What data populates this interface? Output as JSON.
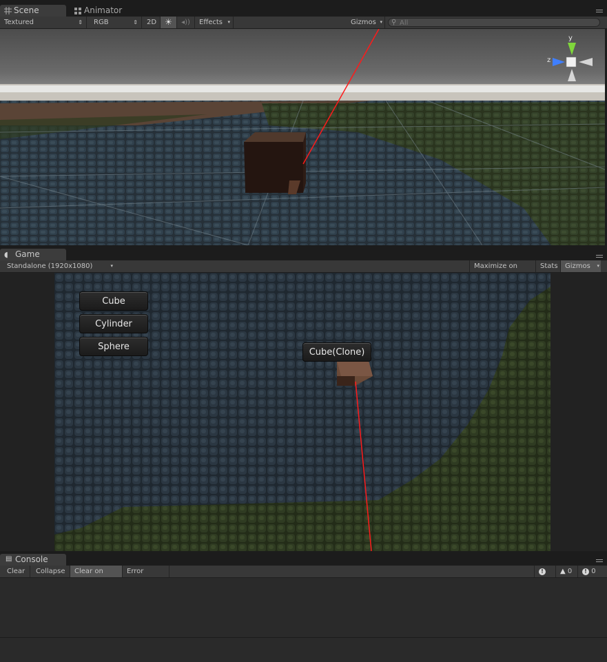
{
  "scene_tab": {
    "label": "Scene",
    "icon": "grid-icon"
  },
  "animator_tab": {
    "label": "Animator",
    "icon": "animator-icon"
  },
  "scene_toolbar": {
    "draw_mode": "Textured",
    "render_mode": "RGB",
    "toggle_2d": "2D",
    "lighting_icon": "sun-icon",
    "audio_icon": "speaker-icon",
    "effects": "Effects",
    "gizmos": "Gizmos",
    "search_placeholder": "All"
  },
  "gizmo_axes": {
    "y": "y",
    "z": "z"
  },
  "game_tab": {
    "label": "Game",
    "icon": "pacman-icon"
  },
  "game_toolbar": {
    "resolution": "Standalone (1920x1080)",
    "maximize": "Maximize on Play",
    "stats": "Stats",
    "gizmos": "Gizmos"
  },
  "game_view": {
    "buttons": [
      "Cube",
      "Cylinder",
      "Sphere"
    ],
    "object_label": "Cube(Clone)"
  },
  "console_tab": {
    "label": "Console",
    "icon": "console-icon"
  },
  "console_toolbar": {
    "clear": "Clear",
    "collapse": "Collapse",
    "clear_on_play": "Clear on Play",
    "error_pause": "Error Pause",
    "error_count": "0",
    "warning_count": "0",
    "info_count": "0"
  },
  "colors": {
    "laser": "#ff1a1a",
    "dark_floor": "#232c36",
    "grass": "#2e3a20",
    "cube": "#4a3328"
  }
}
